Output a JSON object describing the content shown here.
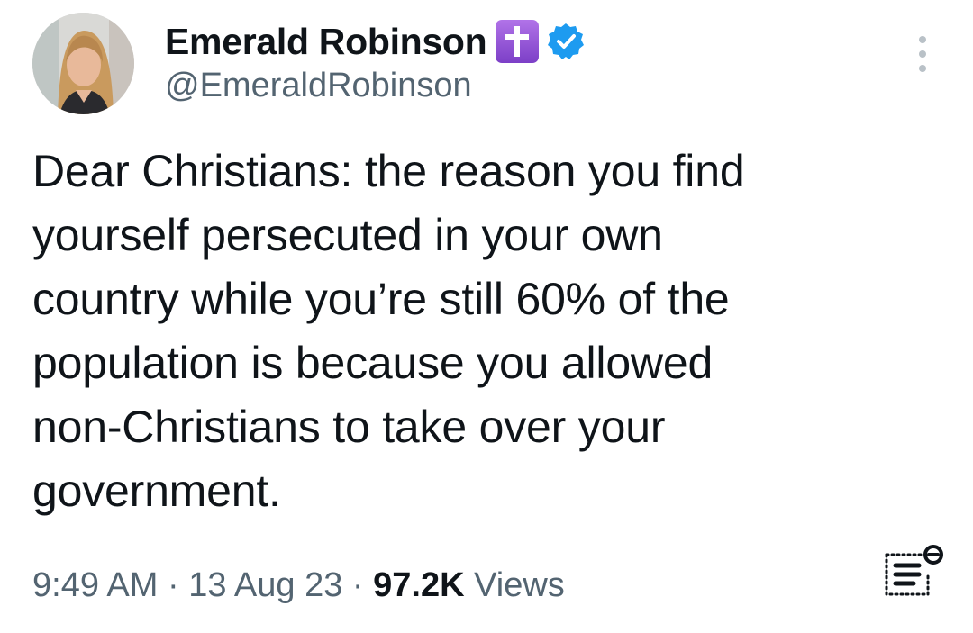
{
  "author": {
    "display_name": "Emerald Robinson",
    "handle": "@EmeraldRobinson",
    "badges": [
      "cross-emoji-icon",
      "verified-badge-icon"
    ],
    "badge_colors": {
      "cross": "#8f4fd6",
      "verified": "#1d9bf0"
    }
  },
  "tweet": {
    "text_lines": [
      "Dear Christians: the reason you find",
      "yourself persecuted in your own",
      "country while you’re still 60% of the",
      "population is because you allowed",
      "non-Christians to take over your",
      "government."
    ]
  },
  "meta": {
    "time": "9:49 AM",
    "separator": " · ",
    "date": "13 Aug 23",
    "views_count": "97.2K",
    "views_label": " Views"
  },
  "icons": {
    "more": "more-options-icon",
    "reader": "reader-mode-icon"
  },
  "colors": {
    "text": "#0f1419",
    "secondary": "#536471",
    "background": "#ffffff"
  }
}
